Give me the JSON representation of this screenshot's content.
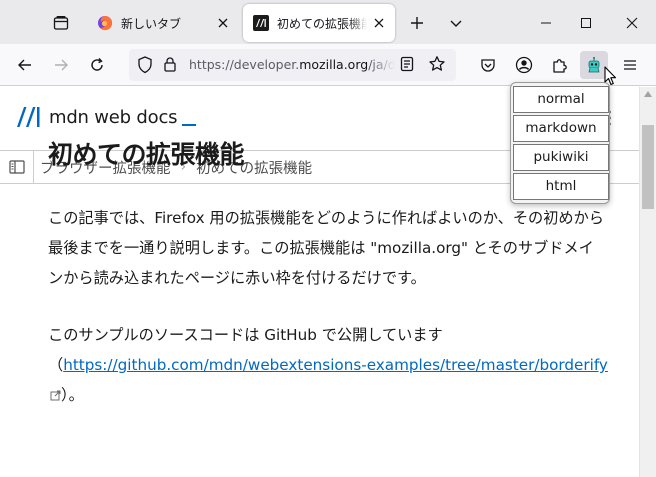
{
  "tabs": [
    {
      "title": "新しいタブ",
      "active": false,
      "favicon": "firefox-icon"
    },
    {
      "title": "初めての拡張機能 - Mozilla",
      "active": true,
      "favicon": "mdn-icon"
    }
  ],
  "toolbar": {
    "url_prefix": "https://developer.",
    "url_domain": "mozilla.org",
    "url_path": "/ja/docs/Mozilla/Add-ons/WebExtensions/Your_first_WebExtension"
  },
  "popup": {
    "options": [
      "normal",
      "markdown",
      "pukiwiki",
      "html"
    ]
  },
  "mdn": {
    "logo_text": "mdn web docs"
  },
  "breadcrumb": {
    "items": [
      "ブラウザー拡張機能",
      "初めての拡張機能"
    ]
  },
  "article": {
    "title": "初めての拡張機能",
    "para1": "この記事では、Firefox 用の拡張機能をどのように作ればよいのか、その初めから最後までを一通り説明します。この拡張機能は \"mozilla.org\" とそのサブドメインから読み込まれたページに赤い枠を付けるだけです。",
    "para2_before": "このサンプルのソースコードは GitHub で公開しています（",
    "para2_link": "https://github.com/mdn/webextensions-examples/tree/master/borderify",
    "para2_after": "）。"
  },
  "colors": {
    "accent": "#0069c2",
    "tabbar": "#eaeaed",
    "toolbar": "#f9f9fb"
  }
}
